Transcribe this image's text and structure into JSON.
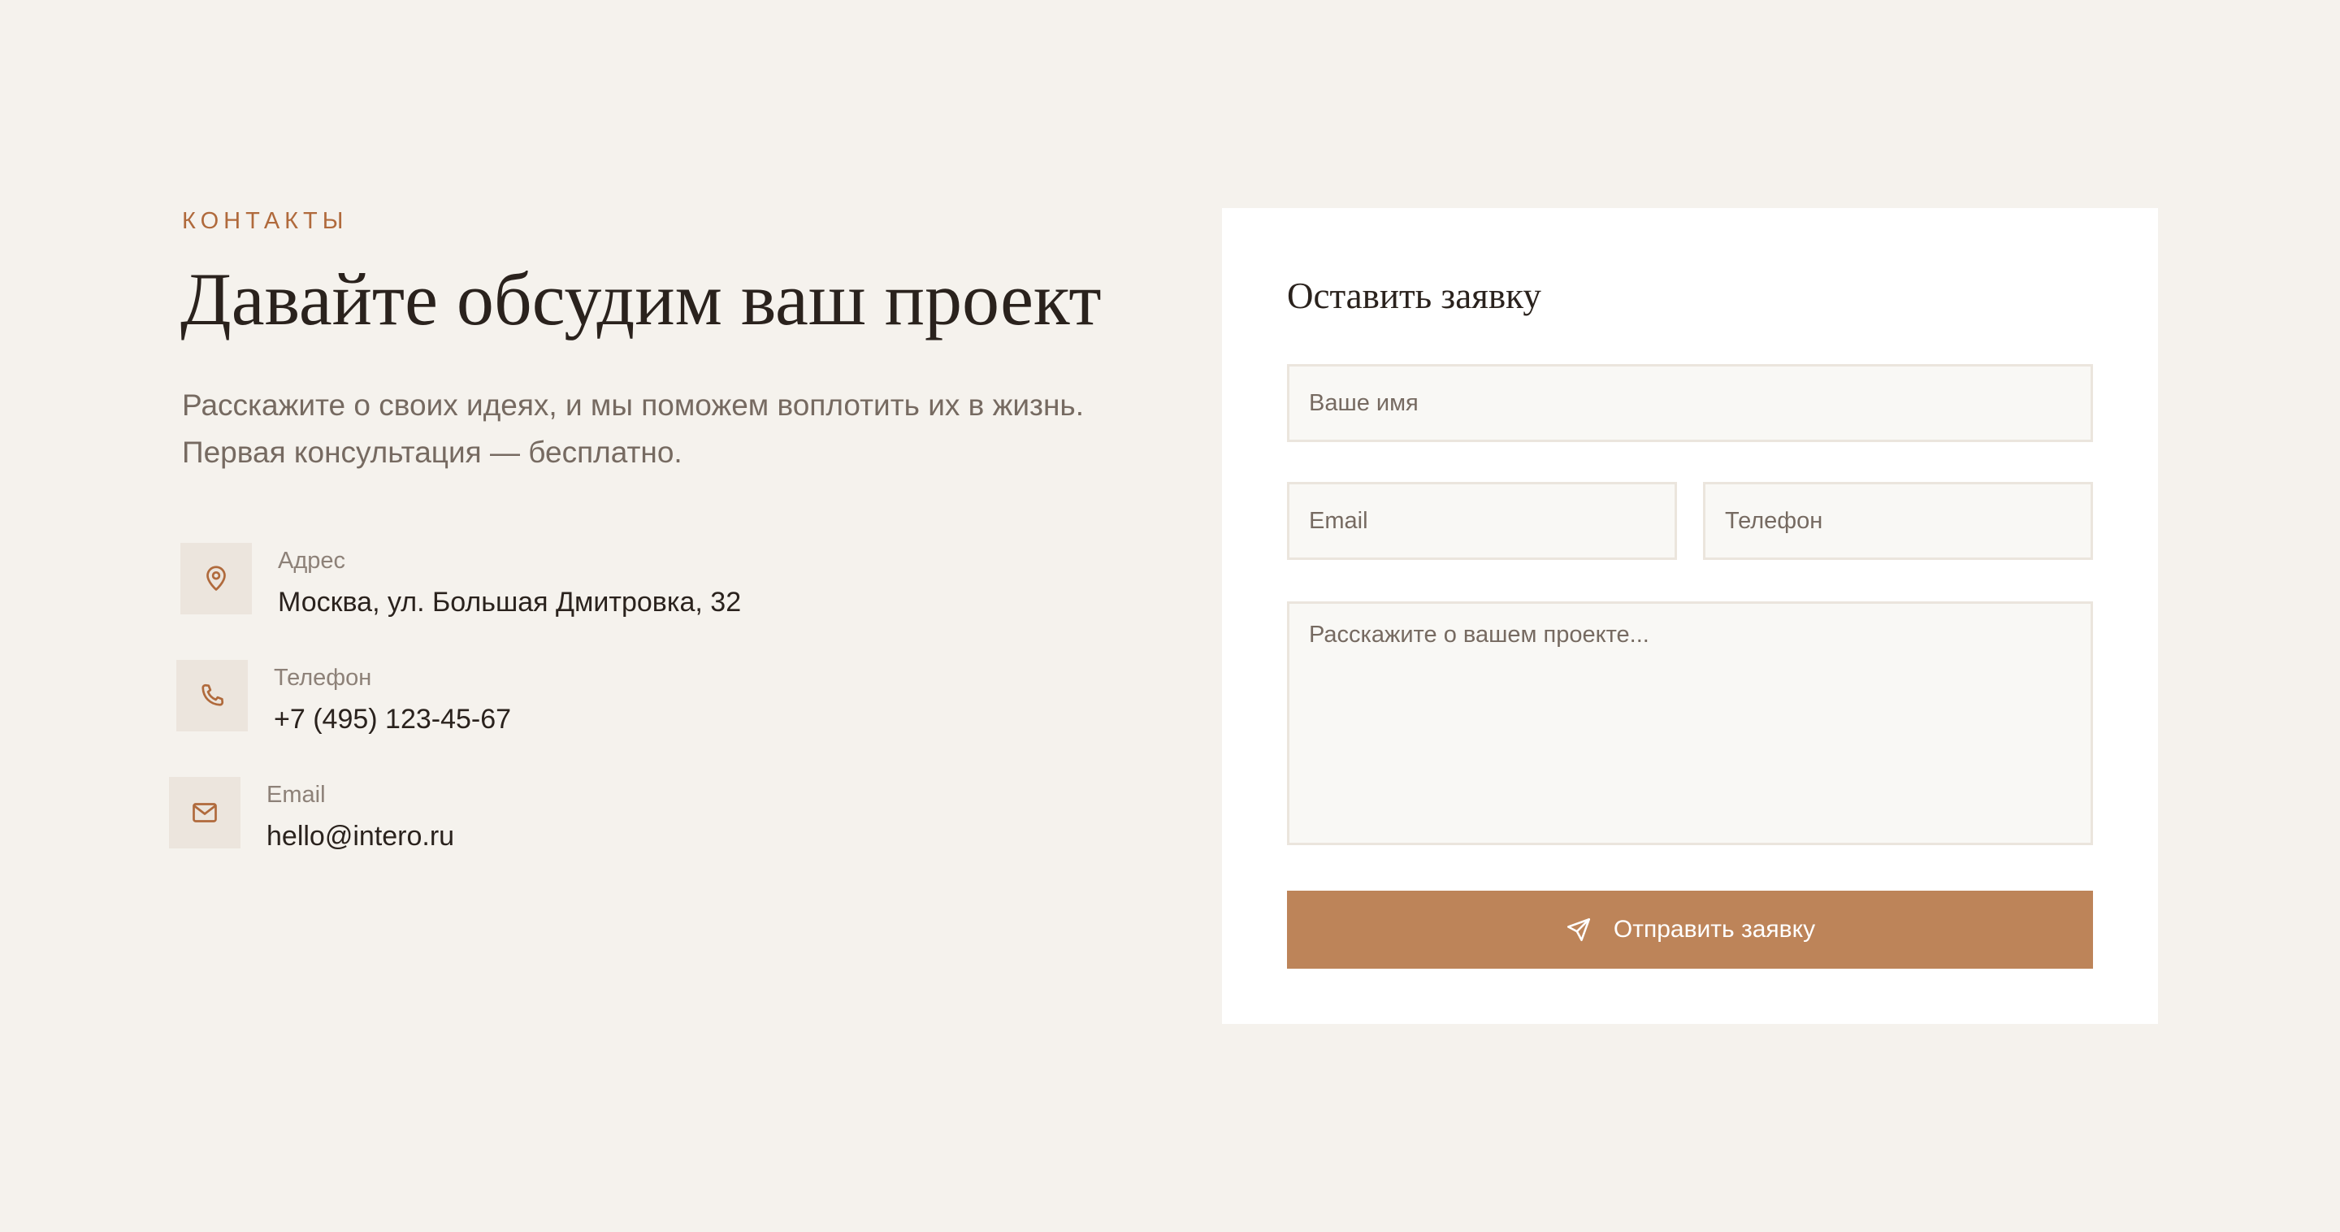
{
  "contacts": {
    "kicker": "КОНТАКТЫ",
    "title": "Давайте обсудим ваш проект",
    "description": "Расскажите о своих идеях, и мы поможем воплотить их в жизнь. Первая консультация — бесплатно.",
    "items": [
      {
        "icon": "map-pin-icon",
        "label": "Адрес",
        "value": "Москва, ул. Большая Дмитровка, 32"
      },
      {
        "icon": "phone-icon",
        "label": "Телефон",
        "value": "+7 (495) 123-45-67"
      },
      {
        "icon": "mail-icon",
        "label": "Email",
        "value": "hello@intero.ru"
      }
    ]
  },
  "form": {
    "title": "Оставить заявку",
    "name_placeholder": "Ваше имя",
    "email_placeholder": "Email",
    "phone_placeholder": "Телефон",
    "message_placeholder": "Расскажите о вашем проекте...",
    "submit_label": "Отправить заявку",
    "submit_icon": "send-icon"
  },
  "colors": {
    "background": "#f5f2ed",
    "accent": "#bd8459",
    "kicker": "#b06a3c",
    "heading": "#2a221d",
    "muted_text": "#766a61",
    "icon_tile": "#ece5dd",
    "field_bg": "#f9f8f5",
    "field_border": "#ebe5dd"
  }
}
